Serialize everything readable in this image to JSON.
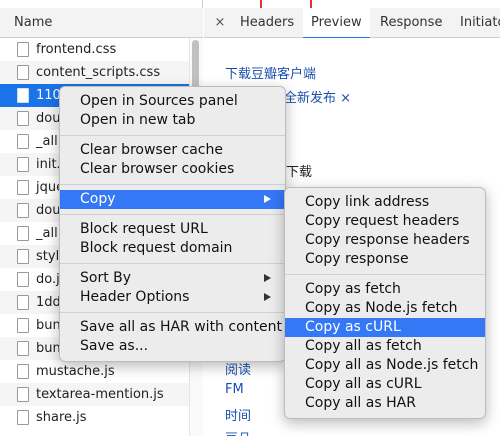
{
  "network": {
    "name_header": "Name",
    "requests": [
      {
        "name": "frontend.css"
      },
      {
        "name": "content_scripts.css"
      },
      {
        "name": "110"
      },
      {
        "name": "dou"
      },
      {
        "name": "_all."
      },
      {
        "name": "init."
      },
      {
        "name": "jque"
      },
      {
        "name": "dou"
      },
      {
        "name": "_all."
      },
      {
        "name": "style"
      },
      {
        "name": "do.j"
      },
      {
        "name": "1dd"
      },
      {
        "name": "bun"
      },
      {
        "name": "bun"
      },
      {
        "name": "mustache.js"
      },
      {
        "name": "textarea-mention.js"
      },
      {
        "name": "share.js"
      }
    ]
  },
  "details": {
    "close": "×",
    "tabs": [
      "Headers",
      "Preview",
      "Response",
      "Initiato"
    ]
  },
  "preview": {
    "line1": "下载豆瓣客户端",
    "line2": "全新发布 ×",
    "line3": "下载",
    "line4": "阅读",
    "line5": "FM",
    "line6": "时间",
    "line7": "豆品"
  },
  "context_menu": {
    "group1": [
      "Open in Sources panel",
      "Open in new tab"
    ],
    "group2": [
      "Clear browser cache",
      "Clear browser cookies"
    ],
    "copy": "Copy",
    "group3": [
      "Block request URL",
      "Block request domain"
    ],
    "sort_by": "Sort By",
    "header_options": "Header Options",
    "group5": [
      "Save all as HAR with content",
      "Save as..."
    ]
  },
  "copy_submenu": {
    "group1": [
      "Copy link address",
      "Copy request headers",
      "Copy response headers",
      "Copy response"
    ],
    "group2": [
      "Copy as fetch",
      "Copy as Node.js fetch",
      "Copy as cURL",
      "Copy all as fetch",
      "Copy all as Node.js fetch",
      "Copy all as cURL",
      "Copy all as HAR"
    ],
    "highlighted": "Copy as cURL"
  }
}
